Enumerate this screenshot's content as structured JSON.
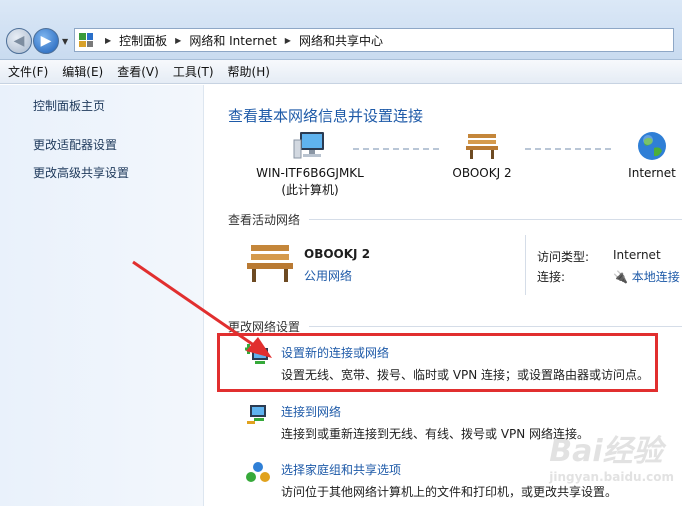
{
  "address": {
    "crumbs": [
      "控制面板",
      "网络和 Internet",
      "网络和共享中心"
    ]
  },
  "menu": [
    "文件(F)",
    "编辑(E)",
    "查看(V)",
    "工具(T)",
    "帮助(H)"
  ],
  "sidebar": {
    "items": [
      {
        "label": "控制面板主页"
      },
      {
        "label": "更改适配器设置"
      },
      {
        "label": "更改高级共享设置"
      }
    ]
  },
  "main": {
    "title": "查看基本网络信息并设置连接",
    "map": {
      "computer_name": "WIN-ITF6B6GJMKL",
      "computer_sub": "(此计算机)",
      "network": "OBOOKJ  2",
      "internet": "Internet"
    },
    "active_label": "查看活动网络",
    "active": {
      "name": "OBOOKJ  2",
      "category": "公用网络",
      "access_type_label": "访问类型:",
      "access_type_value": "Internet",
      "connection_label": "连接:",
      "connection_value": "本地连接"
    },
    "change_label": "更改网络设置",
    "tasks": [
      {
        "link": "设置新的连接或网络",
        "desc": "设置无线、宽带、拨号、临时或 VPN 连接；或设置路由器或访问点。",
        "icon": "new-connection-icon"
      },
      {
        "link": "连接到网络",
        "desc": "连接到或重新连接到无线、有线、拨号或 VPN 网络连接。",
        "icon": "connect-network-icon"
      },
      {
        "link": "选择家庭组和共享选项",
        "desc": "访问位于其他网络计算机上的文件和打印机，或更改共享设置。",
        "icon": "homegroup-icon"
      }
    ]
  },
  "watermark": {
    "main": "Bai经验",
    "sub": "jingyan.baidu.com"
  },
  "colors": {
    "link": "#1e5aa8",
    "highlight": "#e12f2f",
    "arrow": "#e12f2f"
  }
}
